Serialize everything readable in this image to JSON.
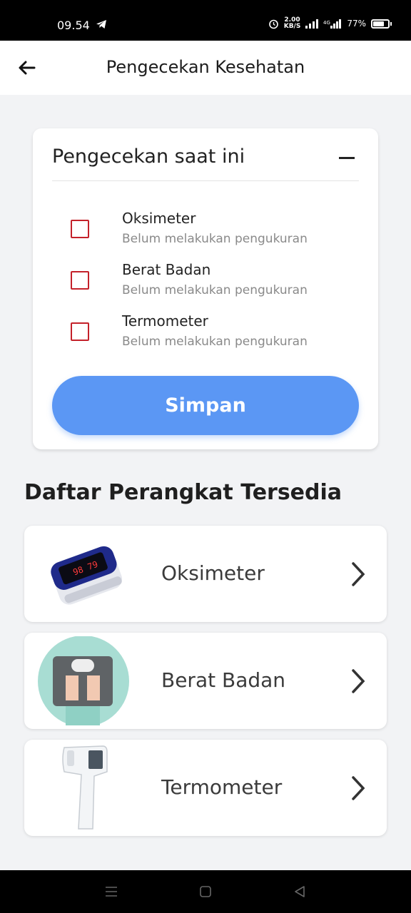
{
  "status_bar": {
    "time": "09.54",
    "speed_value": "2.00",
    "speed_unit": "KB/S",
    "battery": "77%"
  },
  "app_bar": {
    "title": "Pengecekan Kesehatan"
  },
  "current_check": {
    "title": "Pengecekan saat ini",
    "items": [
      {
        "name": "Oksimeter",
        "status": "Belum melakukan pengukuran",
        "checked": false
      },
      {
        "name": "Berat Badan",
        "status": "Belum melakukan pengukuran",
        "checked": false
      },
      {
        "name": "Termometer",
        "status": "Belum melakukan pengukuran",
        "checked": false
      }
    ],
    "save_label": "Simpan"
  },
  "devices": {
    "title": "Daftar Perangkat Tersedia",
    "items": [
      {
        "name": "Oksimeter",
        "icon": "pulse-oximeter-image"
      },
      {
        "name": "Berat Badan",
        "icon": "weight-scale-image"
      },
      {
        "name": "Termometer",
        "icon": "thermometer-gun-image"
      }
    ]
  },
  "colors": {
    "accent": "#5b97f4",
    "checkbox": "#c4212a"
  }
}
